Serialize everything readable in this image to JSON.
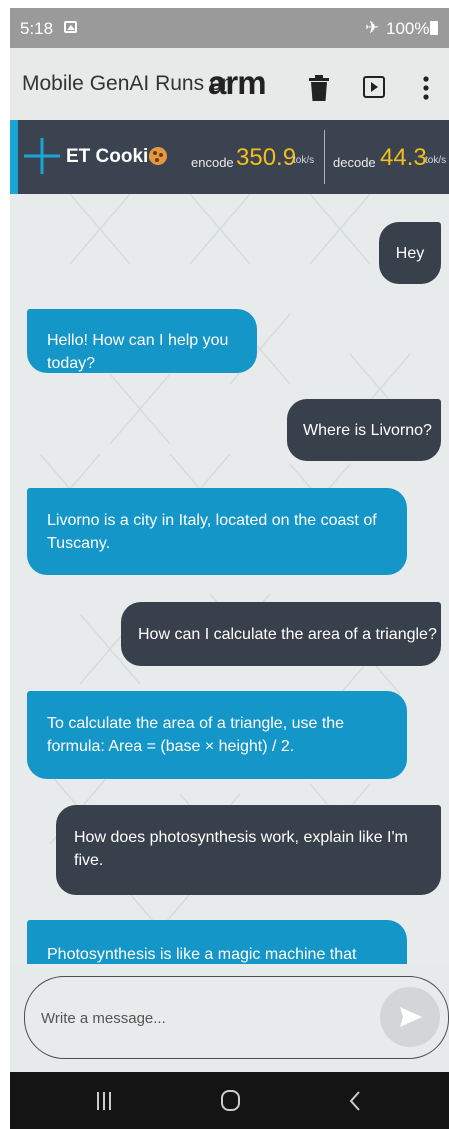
{
  "status_bar": {
    "time": "5:18",
    "battery": "100%",
    "icons": [
      "image-icon",
      "airplane-icon",
      "battery-icon"
    ]
  },
  "app_bar": {
    "title": "Mobile GenAI Runs on",
    "brand": "arm",
    "actions": [
      "trash-icon",
      "play-icon",
      "more-vertical-icon"
    ]
  },
  "model_banner": {
    "model_name": "ET Cookie",
    "encode_label": "encode",
    "encode_value": "350.9",
    "encode_unit": "tok/s",
    "decode_label": "decode",
    "decode_value": "44.3",
    "decode_unit": "tok/s",
    "accent_color": "#19a6d6",
    "value_color": "#f5bf18"
  },
  "messages": [
    {
      "role": "user",
      "text": "Hey"
    },
    {
      "role": "assistant",
      "text": "Hello! How can I help you today?"
    },
    {
      "role": "user",
      "text": "Where is Livorno?"
    },
    {
      "role": "assistant",
      "line1": "Livorno is a city in Italy, located on the coast of",
      "line2": "Tuscany."
    },
    {
      "role": "user",
      "text": "How can I calculate the area of a triangle?"
    },
    {
      "role": "assistant",
      "line1": "To calculate the area of a triangle, use the",
      "line2": "formula: Area = (base × height) / 2."
    },
    {
      "role": "user",
      "line1": "How does photosynthesis work, explain like I'm",
      "line2": "five."
    },
    {
      "role": "assistant",
      "text": "Photosynthesis is like a magic machine that"
    }
  ],
  "colors": {
    "user_bubble": "#38404b",
    "assistant_bubble": "#1596c9",
    "chat_background": "#e8ebeb"
  },
  "composer": {
    "placeholder": "Write a message..."
  },
  "nav_bar": {
    "buttons": [
      "recent-apps-icon",
      "home-icon",
      "back-icon"
    ]
  }
}
